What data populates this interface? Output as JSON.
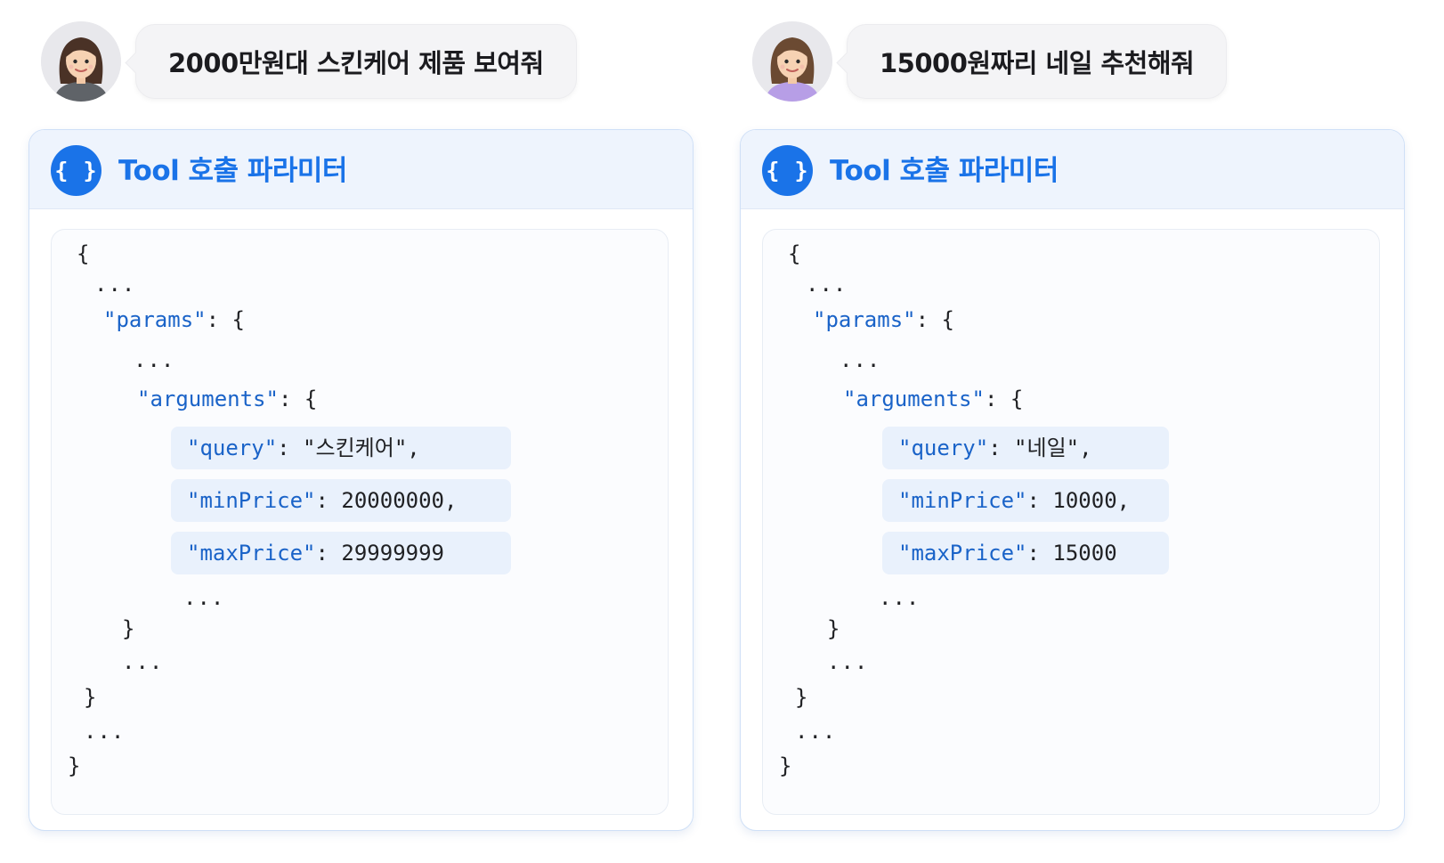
{
  "panels": [
    {
      "prompt": "2000만원대 스킨케어 제품 보여줘",
      "card_title": "Tool 호출 파라미터",
      "brace_icon": "{ }",
      "code": {
        "open_brace": "{",
        "ellipsis": "...",
        "params_key": "\"params\"",
        "arguments_key": "\"arguments\"",
        "colon_open": ": {",
        "close_brace": "}",
        "args": [
          {
            "key": "\"query\"",
            "value": ": \"스킨케어\","
          },
          {
            "key": "\"minPrice\"",
            "value": ": 20000000,"
          },
          {
            "key": "\"maxPrice\"",
            "value": ": 29999999"
          }
        ]
      },
      "avatar_shirt_color": "#5f6368"
    },
    {
      "prompt": "15000원짜리 네일 추천해줘",
      "card_title": "Tool 호출 파라미터",
      "brace_icon": "{ }",
      "code": {
        "open_brace": "{",
        "ellipsis": "...",
        "params_key": "\"params\"",
        "arguments_key": "\"arguments\"",
        "colon_open": ": {",
        "close_brace": "}",
        "args": [
          {
            "key": "\"query\"",
            "value": ": \"네일\","
          },
          {
            "key": "\"minPrice\"",
            "value": ": 10000,"
          },
          {
            "key": "\"maxPrice\"",
            "value": ": 15000"
          }
        ]
      },
      "avatar_shirt_color": "#b79ee6"
    }
  ],
  "colors": {
    "accent": "#1a73e8",
    "json_key": "#1a63c8",
    "header_bg": "#eef4fd",
    "highlight_bg": "#e9f1fc",
    "bubble_bg": "#f4f4f6"
  }
}
